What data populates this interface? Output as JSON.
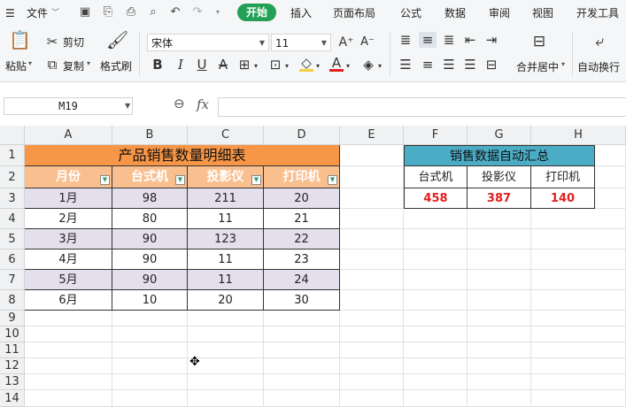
{
  "menu": {
    "file_label": "文件",
    "tabs": [
      "开始",
      "插入",
      "页面布局",
      "公式",
      "数据",
      "审阅",
      "视图",
      "开发工具"
    ]
  },
  "ribbon": {
    "paste": "粘贴",
    "cut": "剪切",
    "copy": "复制",
    "format_painter": "格式刷",
    "font_name": "宋体",
    "font_size": "11",
    "merge_center": "合并居中",
    "wrap_text": "自动换行"
  },
  "formula_bar": {
    "cell_ref": "M19",
    "fx": "fx",
    "value": ""
  },
  "sheet": {
    "columns": [
      "A",
      "B",
      "C",
      "D",
      "E",
      "F",
      "G",
      "H"
    ],
    "rows": [
      "1",
      "2",
      "3",
      "4",
      "5",
      "6",
      "7",
      "8",
      "9",
      "10",
      "11",
      "12",
      "13",
      "14"
    ],
    "table_title": "产品销售数量明细表",
    "headers": [
      "月份",
      "台式机",
      "投影仪",
      "打印机"
    ],
    "data": [
      [
        "1月",
        "98",
        "211",
        "20"
      ],
      [
        "2月",
        "80",
        "11",
        "21"
      ],
      [
        "3月",
        "90",
        "123",
        "22"
      ],
      [
        "4月",
        "90",
        "11",
        "23"
      ],
      [
        "5月",
        "90",
        "11",
        "24"
      ],
      [
        "6月",
        "10",
        "20",
        "30"
      ]
    ],
    "summary_title": "销售数据自动汇总",
    "summary_headers": [
      "台式机",
      "投影仪",
      "打印机"
    ],
    "summary_values": [
      "458",
      "387",
      "140"
    ]
  },
  "colors": {
    "title_orange": "#f79646",
    "header_peach": "#fabf8f",
    "band_lavender": "#e4dfec",
    "summary_teal": "#4bacc6",
    "summary_red": "#e02020",
    "accent_green": "#23a056"
  }
}
